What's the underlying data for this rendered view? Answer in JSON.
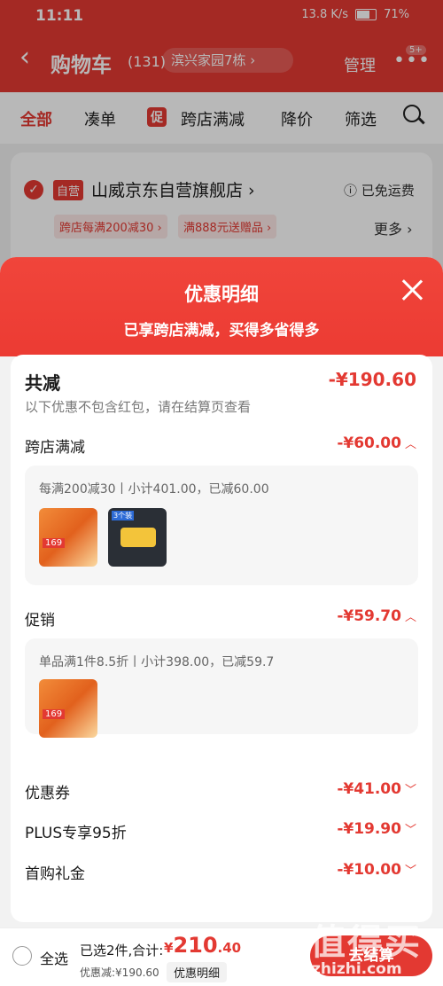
{
  "status_bar": {
    "time": "11:11",
    "net": "13.8 K/s",
    "battery": "71%"
  },
  "header": {
    "back_icon": "chevron-left",
    "title": "购物车",
    "count": "(131)",
    "address": "滨兴家园7栋 ›",
    "manage": "管理",
    "more_badge": "5+"
  },
  "tabs": {
    "all": "全部",
    "combine": "凑单",
    "promo_tag": "促",
    "cross_store": "跨店满减",
    "price_drop": "降价",
    "filter": "筛选"
  },
  "store": {
    "self_tag": "自营",
    "name": "山威京东自营旗舰店 ›",
    "free_shipping": "ⓘ 已免运费",
    "chips": [
      "跨店每满200减30 ›",
      "满888元送赠品 ›"
    ],
    "more": "更多 ›"
  },
  "sheet": {
    "title": "优惠明细",
    "subtitle": "已享跨店满减，买得多省得多",
    "total_label": "共减",
    "total_amount": "-¥190.60",
    "total_note": "以下优惠不包含红包，请在结算页查看",
    "sections": {
      "cross_store": {
        "label": "跨店满减",
        "amount": "-¥60.00",
        "detail": "每满200减30丨小计401.00，已减60.00"
      },
      "promotion": {
        "label": "促销",
        "amount": "-¥59.70",
        "detail": "单品满1件8.5折丨小计398.00，已减59.7"
      },
      "coupon": {
        "label": "优惠券",
        "amount": "-¥41.00"
      },
      "plus": {
        "label": "PLUS专享95折",
        "amount": "-¥19.90"
      },
      "first_buy": {
        "label": "首购礼金",
        "amount": "-¥10.00"
      }
    },
    "thumb2_label": "3个装",
    "thumb_price": "169"
  },
  "bottom": {
    "select_all": "全选",
    "selected": "已选2件,合计:",
    "currency": "¥",
    "total_int": "210",
    "total_dec": ".40",
    "saved": "优惠减:¥190.60",
    "detail_btn": "优惠明细",
    "checkout": "去结算"
  },
  "watermark": {
    "big": "值得买",
    "small": "zhizhi.com"
  },
  "colors": {
    "accent": "#e33932"
  }
}
